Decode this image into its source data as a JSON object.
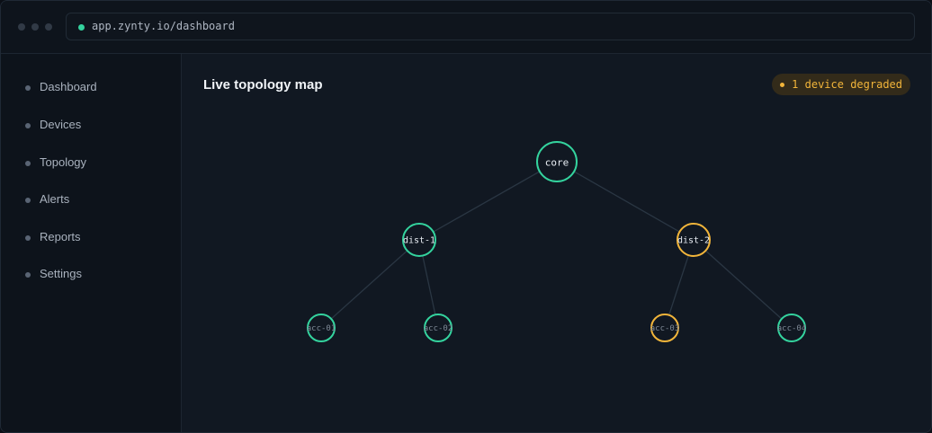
{
  "browser": {
    "url": "app.zynty.io/dashboard"
  },
  "sidebar": {
    "items": [
      {
        "label": "Dashboard"
      },
      {
        "label": "Devices"
      },
      {
        "label": "Topology"
      },
      {
        "label": "Alerts"
      },
      {
        "label": "Reports"
      },
      {
        "label": "Settings"
      }
    ]
  },
  "main": {
    "title": "Live topology map",
    "status_badge": "1 device degraded"
  },
  "topology": {
    "nodes": [
      {
        "id": "core",
        "label": "core",
        "status": "healthy"
      },
      {
        "id": "dist-1",
        "label": "dist-1",
        "status": "healthy"
      },
      {
        "id": "dist-2",
        "label": "dist-2",
        "status": "degraded"
      },
      {
        "id": "acc-01",
        "label": "acc-01",
        "status": "healthy"
      },
      {
        "id": "acc-02",
        "label": "acc-02",
        "status": "healthy"
      },
      {
        "id": "acc-03",
        "label": "acc-03",
        "status": "degraded"
      },
      {
        "id": "acc-04",
        "label": "acc-04",
        "status": "healthy"
      }
    ],
    "edges": [
      [
        "core",
        "dist-1"
      ],
      [
        "core",
        "dist-2"
      ],
      [
        "dist-1",
        "acc-01"
      ],
      [
        "dist-1",
        "acc-02"
      ],
      [
        "dist-2",
        "acc-03"
      ],
      [
        "dist-2",
        "acc-04"
      ]
    ],
    "colors": {
      "healthy": "#34d39e",
      "degraded": "#f2b53a"
    }
  }
}
